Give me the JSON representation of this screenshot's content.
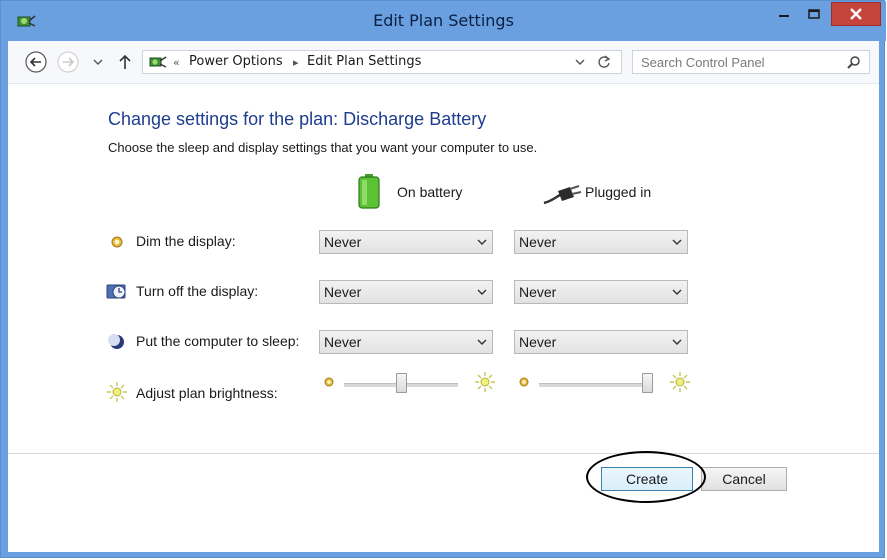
{
  "window": {
    "title": "Edit Plan Settings"
  },
  "breadcrumb": {
    "items": [
      "Power Options",
      "Edit Plan Settings"
    ]
  },
  "search": {
    "placeholder": "Search Control Panel"
  },
  "content": {
    "heading": "Change settings for the plan: Discharge Battery",
    "subtext": "Choose the sleep and display settings that you want your computer to use.",
    "columns": {
      "battery": "On battery",
      "plugged": "Plugged in"
    },
    "rows": [
      {
        "label": "Dim the display:",
        "battery": "Never",
        "plugged": "Never"
      },
      {
        "label": "Turn off the display:",
        "battery": "Never",
        "plugged": "Never"
      },
      {
        "label": "Put the computer to sleep:",
        "battery": "Never",
        "plugged": "Never"
      }
    ],
    "brightness": {
      "label": "Adjust plan brightness:",
      "battery_level": 0.5,
      "plugged_level": 0.95
    }
  },
  "footer": {
    "create_label": "Create",
    "cancel_label": "Cancel"
  },
  "colors": {
    "titlebar": "#6aa0e0",
    "heading": "#1e3d8f",
    "close_button": "#c4433a"
  }
}
